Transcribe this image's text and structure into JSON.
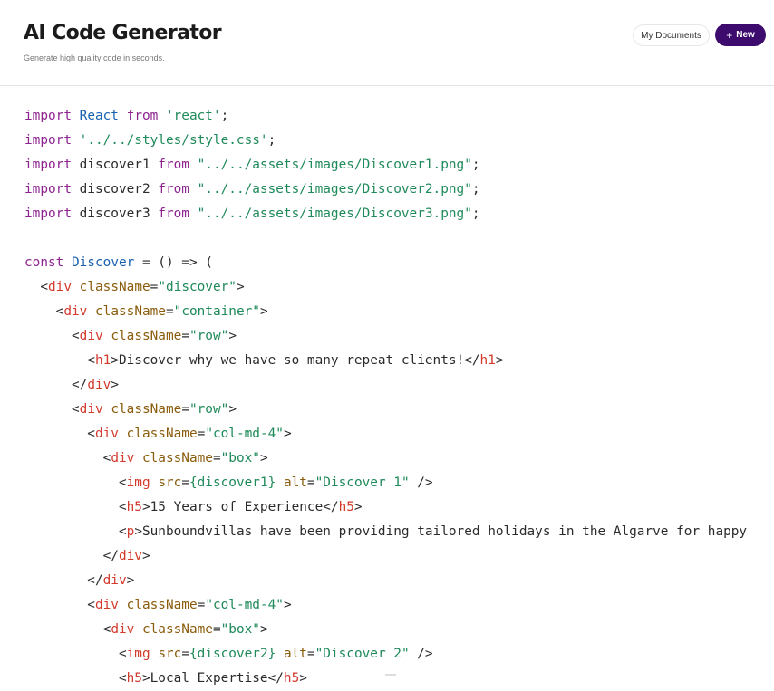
{
  "header": {
    "title": "AI Code Generator",
    "subtitle": "Generate high quality code in seconds.",
    "my_documents_label": "My Documents",
    "new_plus": "+",
    "new_label": "New"
  },
  "colors": {
    "brand": "#3d0a6e",
    "keyword": "#8e2490",
    "string": "#1f8a59",
    "tag": "#d33a2c",
    "attribute": "#8a5c0c",
    "identifier": "#1a62b0"
  },
  "code_lines": [
    [
      {
        "t": "import",
        "c": "kw"
      },
      {
        "t": " "
      },
      {
        "t": "React",
        "c": "id"
      },
      {
        "t": " "
      },
      {
        "t": "from",
        "c": "kw"
      },
      {
        "t": " "
      },
      {
        "t": "'react'",
        "c": "str"
      },
      {
        "t": ";"
      }
    ],
    [
      {
        "t": "import",
        "c": "kw"
      },
      {
        "t": " "
      },
      {
        "t": "'../../styles/style.css'",
        "c": "str"
      },
      {
        "t": ";"
      }
    ],
    [
      {
        "t": "import",
        "c": "kw"
      },
      {
        "t": " discover1 "
      },
      {
        "t": "from",
        "c": "kw"
      },
      {
        "t": " "
      },
      {
        "t": "\"../../assets/images/Discover1.png\"",
        "c": "str"
      },
      {
        "t": ";"
      }
    ],
    [
      {
        "t": "import",
        "c": "kw"
      },
      {
        "t": " discover2 "
      },
      {
        "t": "from",
        "c": "kw"
      },
      {
        "t": " "
      },
      {
        "t": "\"../../assets/images/Discover2.png\"",
        "c": "str"
      },
      {
        "t": ";"
      }
    ],
    [
      {
        "t": "import",
        "c": "kw"
      },
      {
        "t": " discover3 "
      },
      {
        "t": "from",
        "c": "kw"
      },
      {
        "t": " "
      },
      {
        "t": "\"../../assets/images/Discover3.png\"",
        "c": "str"
      },
      {
        "t": ";"
      }
    ],
    [],
    [
      {
        "t": "const",
        "c": "kw"
      },
      {
        "t": " "
      },
      {
        "t": "Discover",
        "c": "id"
      },
      {
        "t": " = () => ("
      }
    ],
    [
      {
        "t": "  <"
      },
      {
        "t": "div",
        "c": "tag"
      },
      {
        "t": " "
      },
      {
        "t": "className",
        "c": "attr"
      },
      {
        "t": "="
      },
      {
        "t": "\"discover\"",
        "c": "str"
      },
      {
        "t": ">"
      }
    ],
    [
      {
        "t": "    <"
      },
      {
        "t": "div",
        "c": "tag"
      },
      {
        "t": " "
      },
      {
        "t": "className",
        "c": "attr"
      },
      {
        "t": "="
      },
      {
        "t": "\"container\"",
        "c": "str"
      },
      {
        "t": ">"
      }
    ],
    [
      {
        "t": "      <"
      },
      {
        "t": "div",
        "c": "tag"
      },
      {
        "t": " "
      },
      {
        "t": "className",
        "c": "attr"
      },
      {
        "t": "="
      },
      {
        "t": "\"row\"",
        "c": "str"
      },
      {
        "t": ">"
      }
    ],
    [
      {
        "t": "        <"
      },
      {
        "t": "h1",
        "c": "tag"
      },
      {
        "t": ">Discover why we have so many repeat clients!</"
      },
      {
        "t": "h1",
        "c": "tag"
      },
      {
        "t": ">"
      }
    ],
    [
      {
        "t": "      </"
      },
      {
        "t": "div",
        "c": "tag"
      },
      {
        "t": ">"
      }
    ],
    [
      {
        "t": "      <"
      },
      {
        "t": "div",
        "c": "tag"
      },
      {
        "t": " "
      },
      {
        "t": "className",
        "c": "attr"
      },
      {
        "t": "="
      },
      {
        "t": "\"row\"",
        "c": "str"
      },
      {
        "t": ">"
      }
    ],
    [
      {
        "t": "        <"
      },
      {
        "t": "div",
        "c": "tag"
      },
      {
        "t": " "
      },
      {
        "t": "className",
        "c": "attr"
      },
      {
        "t": "="
      },
      {
        "t": "\"col-md-4\"",
        "c": "str"
      },
      {
        "t": ">"
      }
    ],
    [
      {
        "t": "          <"
      },
      {
        "t": "div",
        "c": "tag"
      },
      {
        "t": " "
      },
      {
        "t": "className",
        "c": "attr"
      },
      {
        "t": "="
      },
      {
        "t": "\"box\"",
        "c": "str"
      },
      {
        "t": ">"
      }
    ],
    [
      {
        "t": "            <"
      },
      {
        "t": "img",
        "c": "tag"
      },
      {
        "t": " "
      },
      {
        "t": "src",
        "c": "attr"
      },
      {
        "t": "="
      },
      {
        "t": "{discover1}",
        "c": "str"
      },
      {
        "t": " "
      },
      {
        "t": "alt",
        "c": "attr"
      },
      {
        "t": "="
      },
      {
        "t": "\"Discover 1\"",
        "c": "str"
      },
      {
        "t": " />"
      }
    ],
    [
      {
        "t": "            <"
      },
      {
        "t": "h5",
        "c": "tag"
      },
      {
        "t": ">15 Years of Experience</"
      },
      {
        "t": "h5",
        "c": "tag"
      },
      {
        "t": ">"
      }
    ],
    [
      {
        "t": "            <"
      },
      {
        "t": "p",
        "c": "tag"
      },
      {
        "t": ">Sunboundvillas have been providing tailored holidays in the Algarve for happy"
      }
    ],
    [
      {
        "t": "          </"
      },
      {
        "t": "div",
        "c": "tag"
      },
      {
        "t": ">"
      }
    ],
    [
      {
        "t": "        </"
      },
      {
        "t": "div",
        "c": "tag"
      },
      {
        "t": ">"
      }
    ],
    [
      {
        "t": "        <"
      },
      {
        "t": "div",
        "c": "tag"
      },
      {
        "t": " "
      },
      {
        "t": "className",
        "c": "attr"
      },
      {
        "t": "="
      },
      {
        "t": "\"col-md-4\"",
        "c": "str"
      },
      {
        "t": ">"
      }
    ],
    [
      {
        "t": "          <"
      },
      {
        "t": "div",
        "c": "tag"
      },
      {
        "t": " "
      },
      {
        "t": "className",
        "c": "attr"
      },
      {
        "t": "="
      },
      {
        "t": "\"box\"",
        "c": "str"
      },
      {
        "t": ">"
      }
    ],
    [
      {
        "t": "            <"
      },
      {
        "t": "img",
        "c": "tag"
      },
      {
        "t": " "
      },
      {
        "t": "src",
        "c": "attr"
      },
      {
        "t": "="
      },
      {
        "t": "{discover2}",
        "c": "str"
      },
      {
        "t": " "
      },
      {
        "t": "alt",
        "c": "attr"
      },
      {
        "t": "="
      },
      {
        "t": "\"Discover 2\"",
        "c": "str"
      },
      {
        "t": " />"
      }
    ],
    [
      {
        "t": "            <"
      },
      {
        "t": "h5",
        "c": "tag"
      },
      {
        "t": ">Local Expertise</"
      },
      {
        "t": "h5",
        "c": "tag"
      },
      {
        "t": ">"
      }
    ]
  ]
}
